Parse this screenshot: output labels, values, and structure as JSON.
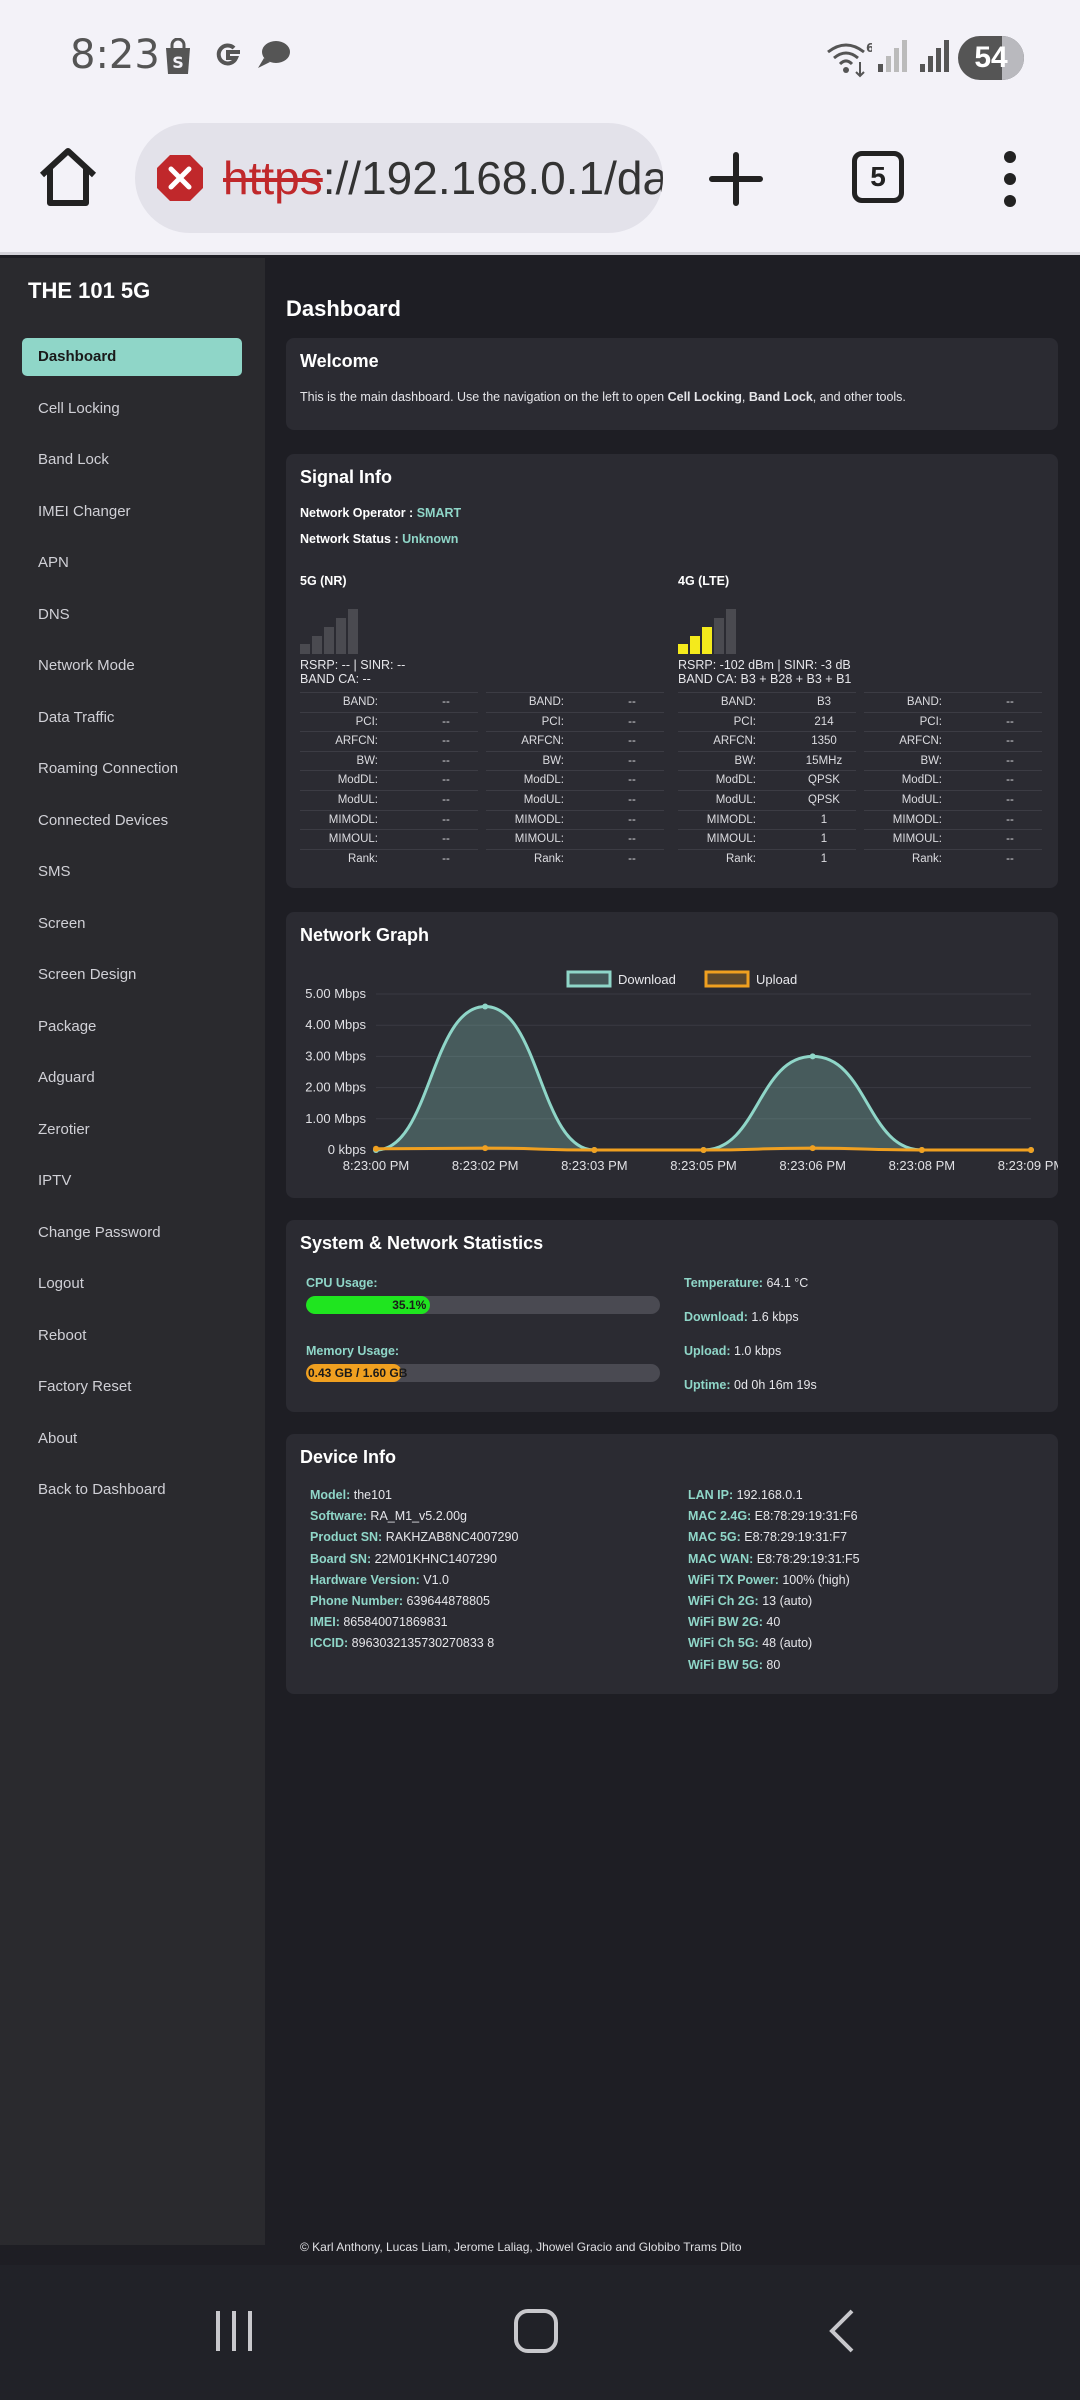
{
  "status_bar": {
    "time": "8:23",
    "battery": "54"
  },
  "browser": {
    "url_scheme": "https",
    "url_rest": "://192.168.0.1/da",
    "tab_count": "5"
  },
  "sidebar": {
    "brand": "THE 101 5G",
    "items": [
      "Dashboard",
      "Cell Locking",
      "Band Lock",
      "IMEI Changer",
      "APN",
      "DNS",
      "Network Mode",
      "Data Traffic",
      "Roaming Connection",
      "Connected Devices",
      "SMS",
      "Screen",
      "Screen Design",
      "Package",
      "Adguard",
      "Zerotier",
      "IPTV",
      "Change Password",
      "Logout",
      "Reboot",
      "Factory Reset",
      "About",
      "Back to Dashboard"
    ]
  },
  "page_title": "Dashboard",
  "welcome": {
    "title": "Welcome",
    "text_1": "This is the main dashboard. Use the navigation on the left to open ",
    "bold_1": "Cell Locking",
    "text_2": ", ",
    "bold_2": "Band Lock",
    "text_3": ", and other tools."
  },
  "signal": {
    "title": "Signal Info",
    "operator_label": "Network Operator : ",
    "operator_value": "SMART",
    "status_label": "Network Status : ",
    "status_value": "Unknown",
    "nr": {
      "title": "5G (NR)",
      "rsrp_line": "RSRP: -- | SINR: --",
      "band_ca": "BAND CA: --",
      "bars_active": 0,
      "bar_color": "#4a4a50"
    },
    "lte": {
      "title": "4G (LTE)",
      "rsrp_line": "RSRP: -102 dBm | SINR: -3 dB",
      "band_ca": "BAND CA: B3 + B28 + B3 + B1",
      "bars_active": 3,
      "bar_color": "#f4ea1c"
    },
    "row_labels": [
      "BAND:",
      "PCI:",
      "ARFCN:",
      "BW:",
      "ModDL:",
      "ModUL:",
      "MIMODL:",
      "MIMOUL:",
      "Rank:"
    ],
    "nr_col1": [
      "--",
      "--",
      "--",
      "--",
      "--",
      "--",
      "--",
      "--",
      "--"
    ],
    "nr_col2": [
      "--",
      "--",
      "--",
      "--",
      "--",
      "--",
      "--",
      "--",
      "--"
    ],
    "lte_col1": [
      "B3",
      "214",
      "1350",
      "15MHz",
      "QPSK",
      "QPSK",
      "1",
      "1",
      "1"
    ],
    "lte_col2": [
      "--",
      "--",
      "--",
      "--",
      "--",
      "--",
      "--",
      "--",
      "--"
    ]
  },
  "graph": {
    "title": "Network Graph",
    "chart_data": {
      "type": "line",
      "title": "",
      "x": [
        "8:23:00 PM",
        "8:23:02 PM",
        "8:23:03 PM",
        "8:23:05 PM",
        "8:23:06 PM",
        "8:23:08 PM",
        "8:23:09 PM"
      ],
      "yticks": [
        "0 kbps",
        "1.00 Mbps",
        "2.00 Mbps",
        "3.00 Mbps",
        "4.00 Mbps",
        "5.00 Mbps"
      ],
      "ylim": [
        0,
        5
      ],
      "series": [
        {
          "name": "Download",
          "color": "#8fd6c8",
          "values": [
            0.0,
            4.6,
            0.0,
            0.0,
            3.0,
            0.0,
            0.0
          ]
        },
        {
          "name": "Upload",
          "color": "#f0a020",
          "values": [
            0.04,
            0.06,
            0.0,
            0.0,
            0.06,
            0.0,
            0.0
          ]
        }
      ],
      "legend": "top-center"
    }
  },
  "stats": {
    "title": "System & Network Statistics",
    "cpu_label": "CPU Usage:",
    "cpu_value": "35.1%",
    "cpu_fraction": 0.351,
    "mem_label": "Memory Usage:",
    "mem_value": "0.43 GB / 1.60 GB",
    "mem_fraction": 0.27,
    "temp_label": "Temperature:",
    "temp_value": " 64.1 °C",
    "dl_label": "Download:",
    "dl_value": " 1.6 kbps",
    "ul_label": "Upload:",
    "ul_value": " 1.0 kbps",
    "up_label": "Uptime:",
    "up_value": " 0d 0h 16m 19s",
    "cpu_color": "#1fe51f",
    "mem_color": "#f0a020"
  },
  "device": {
    "title": "Device Info",
    "left": [
      {
        "k": "Model:",
        "v": " the101"
      },
      {
        "k": "Software:",
        "v": " RA_M1_v5.2.00g"
      },
      {
        "k": "Product SN:",
        "v": " RAKHZAB8NC4007290"
      },
      {
        "k": "Board SN:",
        "v": " 22M01KHNC1407290"
      },
      {
        "k": "Hardware Version:",
        "v": " V1.0"
      },
      {
        "k": "Phone Number:",
        "v": " 639644878805"
      },
      {
        "k": "IMEI:",
        "v": " 865840071869831"
      },
      {
        "k": "ICCID:",
        "v": " 8963032135730270833 8"
      }
    ],
    "right": [
      {
        "k": "LAN IP:",
        "v": " 192.168.0.1"
      },
      {
        "k": "MAC 2.4G:",
        "v": " E8:78:29:19:31:F6"
      },
      {
        "k": "MAC 5G:",
        "v": " E8:78:29:19:31:F7"
      },
      {
        "k": "MAC WAN:",
        "v": " E8:78:29:19:31:F5"
      },
      {
        "k": "WiFi TX Power:",
        "v": " 100% (high)"
      },
      {
        "k": "WiFi Ch 2G:",
        "v": " 13 (auto)"
      },
      {
        "k": "WiFi BW 2G:",
        "v": " 40"
      },
      {
        "k": "WiFi Ch 5G:",
        "v": " 48 (auto)"
      },
      {
        "k": "WiFi BW 5G:",
        "v": " 80"
      }
    ]
  },
  "footer": "© Karl Anthony, Lucas Liam, Jerome Laliag, Jhowel Gracio and Globibo Trams Dito"
}
